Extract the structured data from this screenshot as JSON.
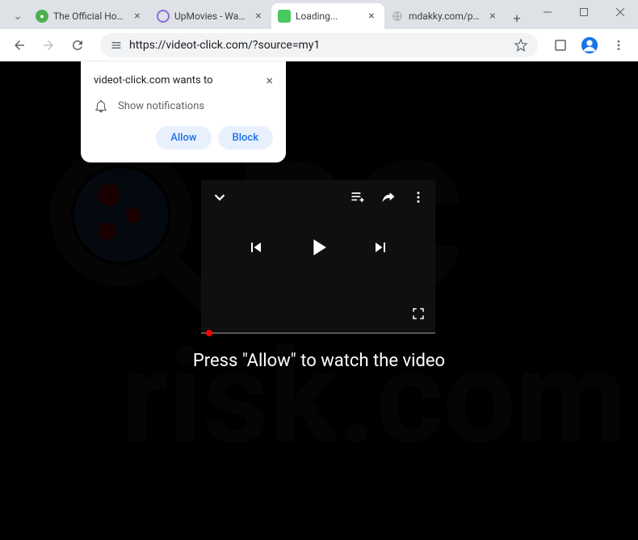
{
  "window": {
    "tabs": [
      {
        "title": "The Official Home of",
        "favicon_color": "#4caf50"
      },
      {
        "title": "UpMovies - Watch FR",
        "favicon_color": "#8b6dd4"
      },
      {
        "title": "Loading...",
        "favicon_color": "#48c95f",
        "active": true
      },
      {
        "title": "mdakky.com/phclcm",
        "favicon_color": "#9aa0a6"
      }
    ]
  },
  "addressbar": {
    "url": "https://videot-click.com/?source=my1"
  },
  "permission": {
    "title": "videot-click.com wants to",
    "body": "Show notifications",
    "allow_label": "Allow",
    "block_label": "Block"
  },
  "page": {
    "instruction": "Press \"Allow\" to watch the video"
  },
  "watermark": {
    "text": "PCrisk.com"
  }
}
